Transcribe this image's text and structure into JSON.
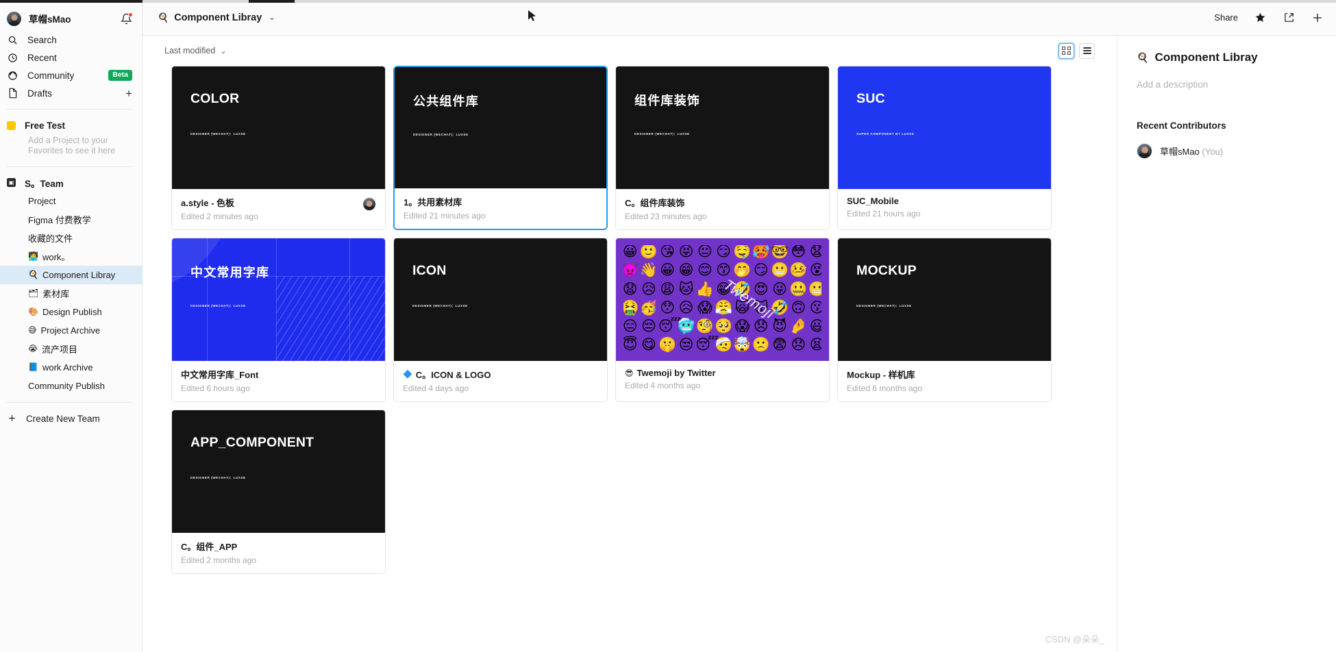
{
  "sidebar": {
    "user": {
      "name": "草帽sMao",
      "avatar": "user-avatar",
      "bell_icon": "bell-icon"
    },
    "nav": [
      {
        "label": "Search",
        "icon": "search-icon",
        "badge": "",
        "trailing": ""
      },
      {
        "label": "Recent",
        "icon": "clock-icon",
        "badge": "",
        "trailing": ""
      },
      {
        "label": "Community",
        "icon": "globe-icon",
        "badge": "Beta",
        "trailing": ""
      },
      {
        "label": "Drafts",
        "icon": "file-icon",
        "badge": "",
        "trailing": "+"
      }
    ],
    "favorites": {
      "title": "Free Test",
      "swatch_color": "#ffc800",
      "hint": "Add a Project to your Favorites to see it here"
    },
    "team": {
      "title": "S。Team",
      "items": [
        {
          "label": "Project",
          "emoji": "",
          "selected": false
        },
        {
          "label": "Figma 付费教学",
          "emoji": "",
          "selected": false
        },
        {
          "label": "收藏的文件",
          "emoji": "",
          "selected": false
        },
        {
          "label": "work。",
          "emoji": "🧑‍💻",
          "selected": false
        },
        {
          "label": "Component Libray",
          "emoji": "🍳",
          "selected": true
        },
        {
          "label": "素材库",
          "emoji": "🗂",
          "selected": false
        },
        {
          "label": "Design Publish",
          "emoji": "🎨",
          "selected": false
        },
        {
          "label": "Project Archive",
          "emoji": "😅",
          "selected": false
        },
        {
          "label": "流产项目",
          "emoji": "😭",
          "selected": false
        },
        {
          "label": "work Archive",
          "emoji": "📘",
          "selected": false
        },
        {
          "label": "Community Publish",
          "emoji": "",
          "selected": false
        }
      ]
    },
    "create_team": {
      "label": "Create New Team",
      "icon": "plus-icon"
    }
  },
  "topbar": {
    "title": "Component Libray",
    "title_emoji": "🍳",
    "dropdown_icon": "chevron-down-icon",
    "share_label": "Share",
    "star_icon": "star-icon",
    "export_icon": "share-export-icon",
    "plus_icon": "plus-icon",
    "cursor_icon": "mouse-cursor"
  },
  "toolbar": {
    "sort_label": "Last modified",
    "sort_chevron": "chevron-down-icon",
    "grid_view_icon": "grid-view-icon",
    "list_view_icon": "list-view-icon",
    "active_view": "grid"
  },
  "files": [
    {
      "thumb_title": "COLOR",
      "thumb_sub": "DESIGNER (WECHAT)：LUXSE",
      "name": "a.style - 色板",
      "name_emoji": "",
      "edited": "Edited 2 minutes ago",
      "bg": "#141414",
      "title_color": "#ffffff",
      "selected": false,
      "has_avatar": true,
      "style": "plain"
    },
    {
      "thumb_title": "公共组件库",
      "thumb_sub": "DESIGNER (WECHAT)：LUXSE",
      "name": "1。共用素材库",
      "name_emoji": "",
      "edited": "Edited 21 minutes ago",
      "bg": "#141414",
      "title_color": "#ffffff",
      "selected": true,
      "has_avatar": false,
      "style": "plain"
    },
    {
      "thumb_title": "组件库装饰",
      "thumb_sub": "DESIGNER (WECHAT)：LUXSE",
      "name": "C。组件库装饰",
      "name_emoji": "",
      "edited": "Edited 23 minutes ago",
      "bg": "#141414",
      "title_color": "#ffffff",
      "selected": false,
      "has_avatar": false,
      "style": "plain"
    },
    {
      "thumb_title": "SUC",
      "thumb_sub": "SUPER COMPONENT BY LUXSE",
      "name": "SUC_Mobile",
      "name_emoji": "",
      "edited": "Edited 21 hours ago",
      "bg": "#1f37f0",
      "title_color": "#ffffff",
      "selected": false,
      "has_avatar": false,
      "style": "plain"
    },
    {
      "thumb_title": "中文常用字库",
      "thumb_sub": "DESIGNER (WECHAT)：LUXSE",
      "name": "中文常用字库_Font",
      "name_emoji": "",
      "edited": "Edited 6 hours ago",
      "bg": "#1f2ced",
      "title_color": "#ffffff",
      "selected": false,
      "has_avatar": false,
      "style": "font-deco"
    },
    {
      "thumb_title": "ICON",
      "thumb_sub": "DESIGNER (WECHAT)：LUXSE",
      "name": "C。ICON & LOGO",
      "name_emoji": "🔷",
      "edited": "Edited 4 days ago",
      "bg": "#141414",
      "title_color": "#ffffff",
      "selected": false,
      "has_avatar": false,
      "style": "plain"
    },
    {
      "thumb_title": "",
      "thumb_sub": "",
      "name": "Twemoji by Twitter",
      "name_emoji": "😎",
      "edited": "Edited 4 months ago",
      "bg": "#7234c8",
      "title_color": "#ffffff",
      "selected": false,
      "has_avatar": false,
      "style": "twemoji",
      "watermark_text": "Twemoji"
    },
    {
      "thumb_title": "MOCKUP",
      "thumb_sub": "DESIGNER (WECHAT)：LUXSE",
      "name": "Mockup - 样机库",
      "name_emoji": "",
      "edited": "Edited 6 months ago",
      "bg": "#141414",
      "title_color": "#ffffff",
      "selected": false,
      "has_avatar": false,
      "style": "plain"
    },
    {
      "thumb_title": "APP_COMPONENT",
      "thumb_sub": "DESIGNER (WECHAT)：LUXSE",
      "name": "C。组件_APP",
      "name_emoji": "",
      "edited": "Edited 2 months ago",
      "bg": "#141414",
      "title_color": "#ffffff",
      "selected": false,
      "has_avatar": false,
      "style": "plain"
    }
  ],
  "right_panel": {
    "title": "Component Libray",
    "title_emoji": "🍳",
    "description_placeholder": "Add a description",
    "contributors_heading": "Recent Contributors",
    "contributors": [
      {
        "name": "草帽sMao",
        "suffix": "(You)"
      }
    ]
  },
  "watermark": "CSDN @朵朵_",
  "colors": {
    "accent_blue": "#1e9cf0",
    "sidebar_selected": "#daeaf7",
    "beta_green": "#0fa958",
    "notification_red": "#f24822",
    "card_dark": "#141414",
    "suc_blue": "#1f37f0",
    "purple": "#7234c8"
  }
}
